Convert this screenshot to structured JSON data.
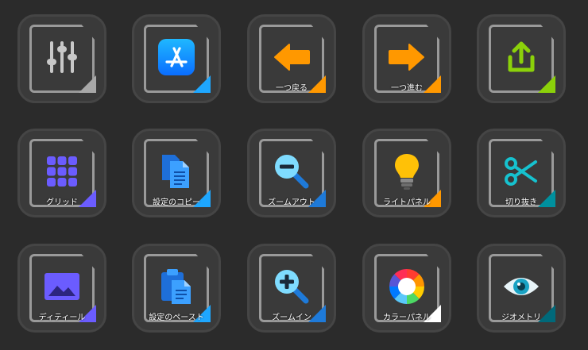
{
  "tiles": [
    {
      "name": "mixer-tile",
      "icon": "sliders-icon",
      "label": "",
      "accent": "#a8a8a8"
    },
    {
      "name": "app-store-tile",
      "icon": "app-store-icon",
      "label": "",
      "accent": "#1ea7ff"
    },
    {
      "name": "back-tile",
      "icon": "arrow-left-icon",
      "label": "一つ戻る",
      "accent": "#ff9800"
    },
    {
      "name": "forward-tile",
      "icon": "arrow-right-icon",
      "label": "一つ進む",
      "accent": "#ff9800"
    },
    {
      "name": "share-tile",
      "icon": "share-icon",
      "label": "",
      "accent": "#8bd10a"
    },
    {
      "name": "grid-tile",
      "icon": "grid-icon",
      "label": "グリッド",
      "accent": "#6b5cff"
    },
    {
      "name": "copy-settings-tile",
      "icon": "copy-icon",
      "label": "設定のコピー",
      "accent": "#1ea7ff"
    },
    {
      "name": "zoom-out-tile",
      "icon": "zoom-out-icon",
      "label": "ズームアウト",
      "accent": "#1e7ad9"
    },
    {
      "name": "light-panel-tile",
      "icon": "light-bulb-icon",
      "label": "ライトパネル",
      "accent": "#ff9800"
    },
    {
      "name": "cut-tile",
      "icon": "scissors-icon",
      "label": "切り抜き",
      "accent": "#00909e"
    },
    {
      "name": "detail-tile",
      "icon": "image-icon",
      "label": "ディティール",
      "accent": "#6b5cff"
    },
    {
      "name": "paste-settings-tile",
      "icon": "clipboard-icon",
      "label": "設定のペースト",
      "accent": "#1ea7ff"
    },
    {
      "name": "zoom-in-tile",
      "icon": "zoom-in-icon",
      "label": "ズームイン",
      "accent": "#1e7ad9"
    },
    {
      "name": "color-panel-tile",
      "icon": "color-wheel-icon",
      "label": "カラーパネル",
      "accent": "#ffffff"
    },
    {
      "name": "geometry-tile",
      "icon": "eye-icon",
      "label": "ジオメトリ",
      "accent": "#00697a"
    }
  ]
}
